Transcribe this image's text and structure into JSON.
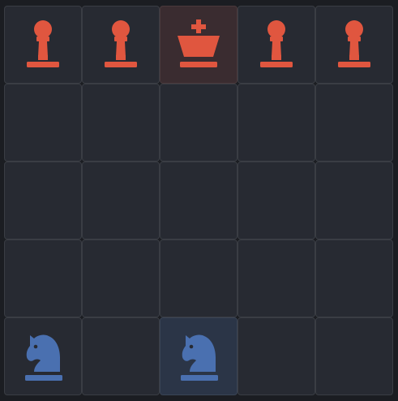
{
  "board": {
    "rows": 5,
    "cols": 5,
    "colors": {
      "red_piece": "#e0563f",
      "blue_piece": "#4a70b0",
      "cell_bg": "#272a32",
      "cell_border": "#3a3d44",
      "highlight_red": "#3a2c30",
      "highlight_blue": "#2b3547"
    },
    "cells": [
      [
        {
          "piece": "pawn",
          "side": "red",
          "highlight": ""
        },
        {
          "piece": "pawn",
          "side": "red",
          "highlight": ""
        },
        {
          "piece": "king",
          "side": "red",
          "highlight": "red"
        },
        {
          "piece": "pawn",
          "side": "red",
          "highlight": ""
        },
        {
          "piece": "pawn",
          "side": "red",
          "highlight": ""
        }
      ],
      [
        {
          "piece": "",
          "side": "",
          "highlight": ""
        },
        {
          "piece": "",
          "side": "",
          "highlight": ""
        },
        {
          "piece": "",
          "side": "",
          "highlight": ""
        },
        {
          "piece": "",
          "side": "",
          "highlight": ""
        },
        {
          "piece": "",
          "side": "",
          "highlight": ""
        }
      ],
      [
        {
          "piece": "",
          "side": "",
          "highlight": ""
        },
        {
          "piece": "",
          "side": "",
          "highlight": ""
        },
        {
          "piece": "",
          "side": "",
          "highlight": ""
        },
        {
          "piece": "",
          "side": "",
          "highlight": ""
        },
        {
          "piece": "",
          "side": "",
          "highlight": ""
        }
      ],
      [
        {
          "piece": "",
          "side": "",
          "highlight": ""
        },
        {
          "piece": "",
          "side": "",
          "highlight": ""
        },
        {
          "piece": "",
          "side": "",
          "highlight": ""
        },
        {
          "piece": "",
          "side": "",
          "highlight": ""
        },
        {
          "piece": "",
          "side": "",
          "highlight": ""
        }
      ],
      [
        {
          "piece": "knight",
          "side": "blue",
          "highlight": ""
        },
        {
          "piece": "",
          "side": "",
          "highlight": ""
        },
        {
          "piece": "knight",
          "side": "blue",
          "highlight": "blue"
        },
        {
          "piece": "",
          "side": "",
          "highlight": ""
        },
        {
          "piece": "",
          "side": "",
          "highlight": ""
        }
      ]
    ]
  }
}
